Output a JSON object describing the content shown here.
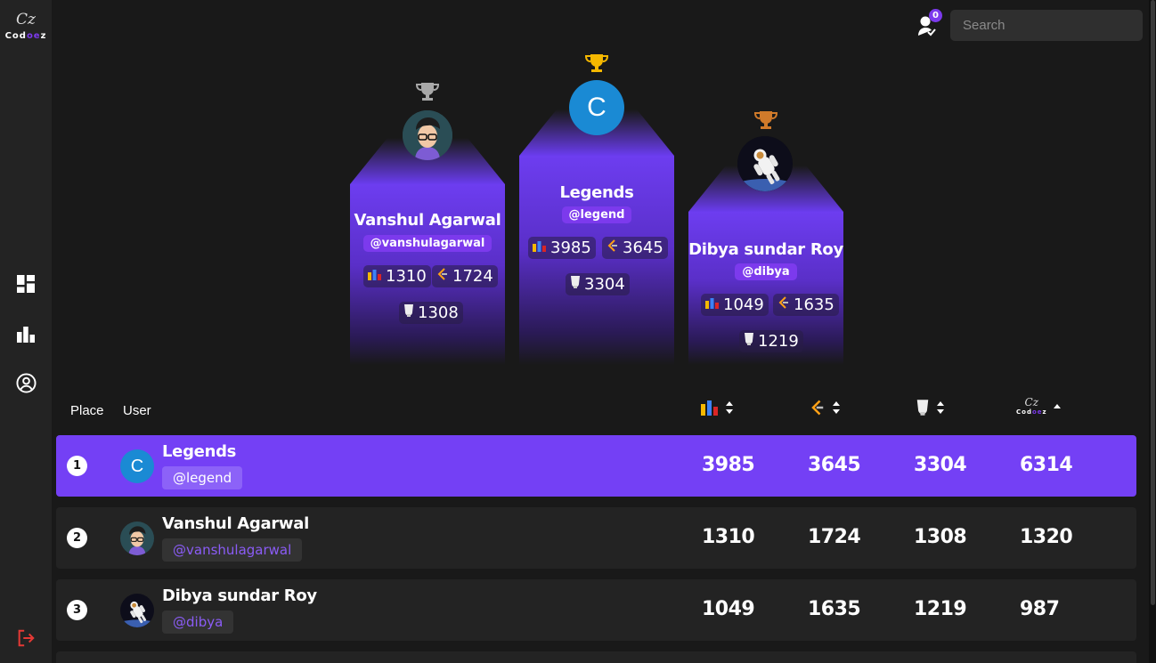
{
  "app": {
    "logo_text": "Codoez",
    "logo_signature": "Cz"
  },
  "sidebar": {
    "items": [
      {
        "icon": "dashboard-icon"
      },
      {
        "icon": "leaderboard-icon"
      },
      {
        "icon": "profile-icon"
      },
      {
        "icon": "logout-icon"
      }
    ]
  },
  "header": {
    "notification_count": "0",
    "search_placeholder": "Search"
  },
  "podium": [
    {
      "place": 2,
      "name": "Vanshul Agarwal",
      "handle": "@vanshulagarwal",
      "codechef": "1310",
      "leetcode": "1724",
      "gfg": "1308",
      "trophy_color": "#a8a8a8"
    },
    {
      "place": 1,
      "name": "Legends",
      "handle": "@legend",
      "codechef": "3985",
      "leetcode": "3645",
      "gfg": "3304",
      "trophy_color": "#f5b800",
      "avatar_letter": "C"
    },
    {
      "place": 3,
      "name": "Dibya sundar Roy",
      "handle": "@dibya",
      "codechef": "1049",
      "leetcode": "1635",
      "gfg": "1219",
      "trophy_color": "#d07a2a"
    }
  ],
  "table": {
    "headers": {
      "place": "Place",
      "user": "User",
      "col_logo": "Codoez"
    },
    "rows": [
      {
        "rank": "1",
        "name": "Legends",
        "handle": "@legend",
        "codechef": "3985",
        "leetcode": "3645",
        "gfg": "3304",
        "codoez": "6314",
        "avatar_letter": "C"
      },
      {
        "rank": "2",
        "name": "Vanshul Agarwal",
        "handle": "@vanshulagarwal",
        "codechef": "1310",
        "leetcode": "1724",
        "gfg": "1308",
        "codoez": "1320"
      },
      {
        "rank": "3",
        "name": "Dibya sundar Roy",
        "handle": "@dibya",
        "codechef": "1049",
        "leetcode": "1635",
        "gfg": "1219",
        "codoez": "987"
      }
    ]
  },
  "colors": {
    "accent": "#7c3aed",
    "highlight_row": "#7440f5",
    "background": "#191919",
    "sidebar": "#232323",
    "logout": "#e53935"
  }
}
